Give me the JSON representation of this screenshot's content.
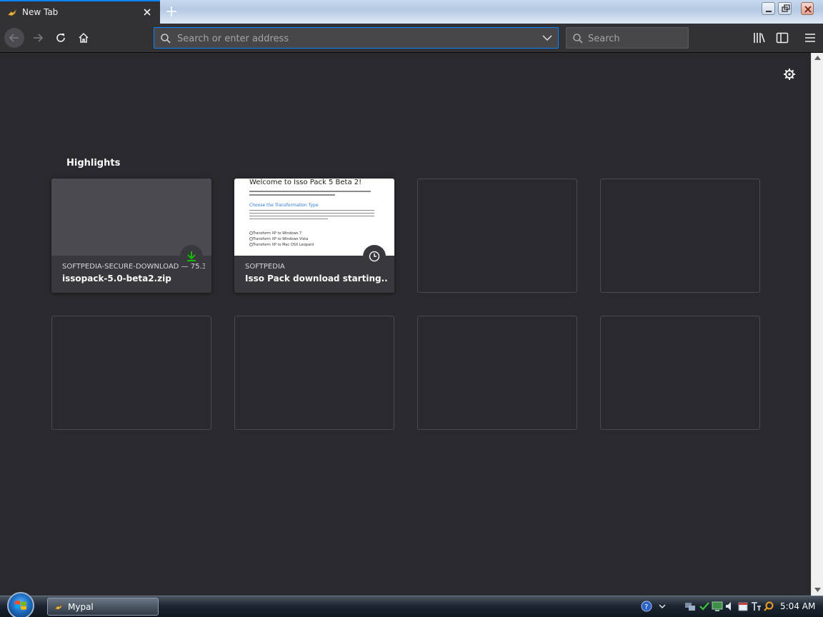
{
  "tab": {
    "title": "New Tab",
    "favicon": "mypal-bird-icon"
  },
  "urlbar": {
    "placeholder": "Search or enter address",
    "value": ""
  },
  "searchbar": {
    "placeholder": "Search",
    "value": ""
  },
  "highlights": {
    "title": "Highlights",
    "cards": [
      {
        "host": "SOFTPEDIA-SECURE-DOWNLOAD — 75.3 …",
        "title": "issopack-5.0-beta2.zip",
        "badge": "download-icon"
      },
      {
        "host": "SOFTPEDIA",
        "title": "Isso Pack download starting...",
        "badge": "clock-icon",
        "preview": {
          "heading": "Welcome to Isso Pack 5 Beta 2!",
          "section": "Choose the Transformation Type",
          "options": [
            "Transform XP to Windows 7",
            "Transform XP to Windows Vista",
            "Transform XP to Mac OSX Leopard"
          ]
        }
      }
    ]
  },
  "taskbar": {
    "app_label": "Mypal",
    "clock": "5:04 AM"
  },
  "colors": {
    "accent": "#0a84ff",
    "download": "#12bc00",
    "background": "#2a2a2e"
  }
}
